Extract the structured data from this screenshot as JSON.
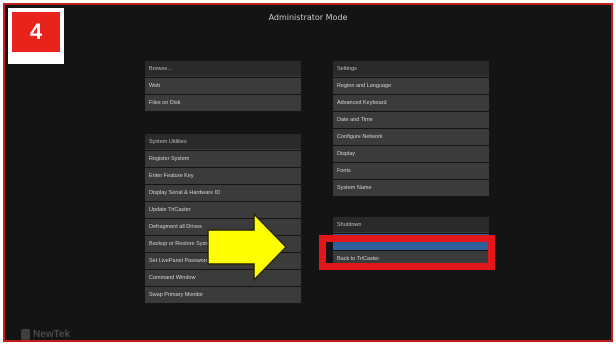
{
  "window": {
    "title": "Administrator Mode"
  },
  "step_badge": {
    "number": "4"
  },
  "browse": {
    "header": "Browse...",
    "items": [
      {
        "label": "Web"
      },
      {
        "label": "Files on Disk"
      }
    ]
  },
  "system_utilities": {
    "header": "System Utilities",
    "items": [
      {
        "label": "Register System"
      },
      {
        "label": "Enter Feature Key"
      },
      {
        "label": "Display Serial & Hardware ID"
      },
      {
        "label": "Update TriCaster"
      },
      {
        "label": "Defragment all Drives"
      },
      {
        "label": "Backup or Restore System"
      },
      {
        "label": "Set LivePanel Password"
      },
      {
        "label": "Command Window"
      },
      {
        "label": "Swap Primary Monitor"
      }
    ]
  },
  "settings": {
    "header": "Settings",
    "items": [
      {
        "label": "Region and Language"
      },
      {
        "label": "Advanced Keyboard"
      },
      {
        "label": "Date and Time"
      },
      {
        "label": "Configure Network"
      },
      {
        "label": "Display"
      },
      {
        "label": "Fonts"
      },
      {
        "label": "System Name"
      }
    ]
  },
  "shutdown": {
    "header": "Shutdown",
    "items": [
      {
        "label": "",
        "selected": true
      },
      {
        "label": "Back to TriCaster",
        "selected": false
      }
    ]
  },
  "logo": {
    "text": "NewTek"
  },
  "colors": {
    "highlight": "#e3161b",
    "arrow_fill": "#ffff00",
    "badge": "#e8231c",
    "selected_item": "#2f5f9a"
  }
}
